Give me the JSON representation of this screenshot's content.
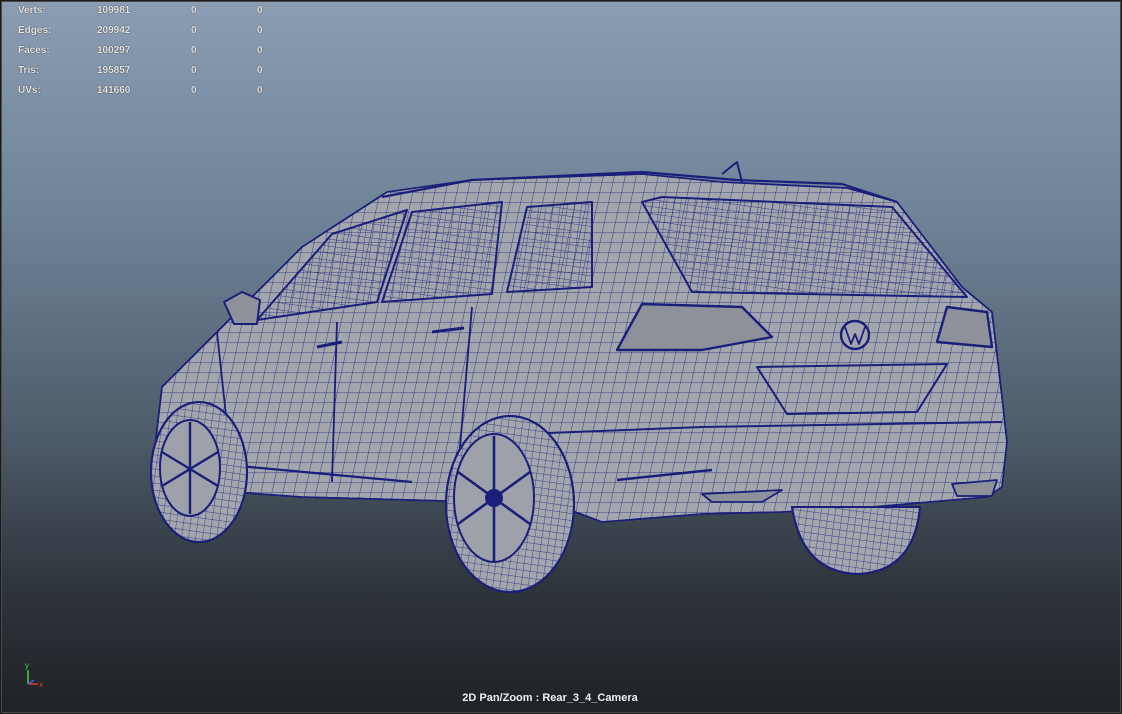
{
  "hud": {
    "rows": [
      {
        "label": "Verts:",
        "v1": "109981",
        "v2": "0",
        "v3": "0"
      },
      {
        "label": "Edges:",
        "v1": "209942",
        "v2": "0",
        "v3": "0"
      },
      {
        "label": "Faces:",
        "v1": "100297",
        "v2": "0",
        "v3": "0"
      },
      {
        "label": "Tris:",
        "v1": "195857",
        "v2": "0",
        "v3": "0"
      },
      {
        "label": "UVs:",
        "v1": "141660",
        "v2": "0",
        "v3": "0"
      }
    ]
  },
  "viewport": {
    "camera_label": "2D Pan/Zoom : Rear_3_4_Camera",
    "wire_color": "#1a1f7a",
    "shade_color": "#a3a6ad"
  },
  "axis": {
    "y_label": "y",
    "x_label": "x"
  }
}
